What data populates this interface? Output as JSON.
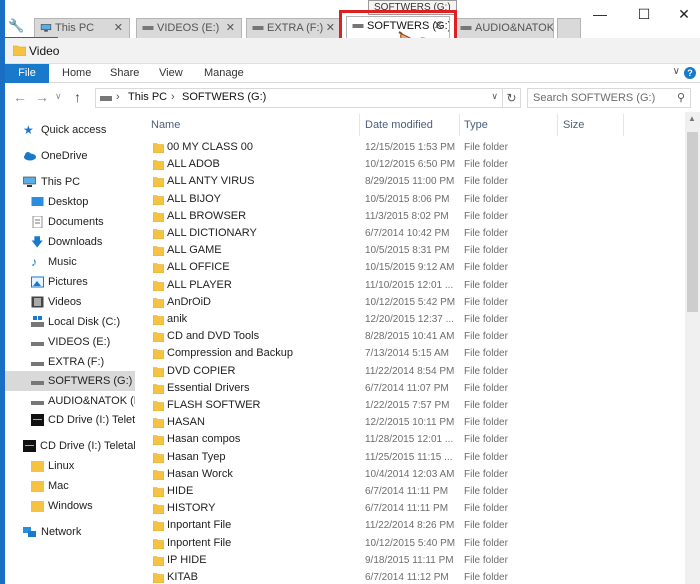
{
  "tooltip": "SOFTWERS (G:)",
  "tabs": [
    {
      "label": "This PC",
      "close": "✕"
    },
    {
      "label": "VIDEOS (E:)",
      "close": "✕"
    },
    {
      "label": "EXTRA (F:)",
      "close": "✕"
    },
    {
      "label": "SOFTWERS (G:)",
      "close": "✕"
    },
    {
      "label": "AUDIO&NATOK",
      "close": "✕"
    }
  ],
  "window_controls": {
    "minimize": "—",
    "maximize": "☐",
    "close": "✕"
  },
  "location": {
    "label": "Video"
  },
  "ribbon": {
    "file": "File",
    "home": "Home",
    "share": "Share",
    "view": "View",
    "manage": "Manage",
    "help": "?"
  },
  "address": {
    "this_pc": "This PC",
    "sep": "›",
    "drive": "SOFTWERS (G:)"
  },
  "search": {
    "placeholder": "Search SOFTWERS (G:)"
  },
  "nav": {
    "quick_access": "Quick access",
    "onedrive": "OneDrive",
    "this_pc": "This PC",
    "desktop": "Desktop",
    "documents": "Documents",
    "downloads": "Downloads",
    "music": "Music",
    "pictures": "Pictures",
    "videos": "Videos",
    "local_disk": "Local Disk (C:)",
    "videos_e": "VIDEOS (E:)",
    "extra_f": "EXTRA (F:)",
    "softwers_g": "SOFTWERS (G:)",
    "audio_h": "AUDIO&NATOK (H:",
    "cd_drive_1": "CD Drive (I:) Teletalk",
    "cd_drive_2": "CD Drive (I:) Teletalk I",
    "linux": "Linux",
    "mac": "Mac",
    "windows": "Windows",
    "network": "Network"
  },
  "columns": {
    "name": "Name",
    "date": "Date modified",
    "type": "Type",
    "size": "Size"
  },
  "files": [
    {
      "name": "00 MY CLASS 00",
      "date": "12/15/2015 1:53 PM",
      "type": "File folder"
    },
    {
      "name": "ALL ADOB",
      "date": "10/12/2015 6:50 PM",
      "type": "File folder"
    },
    {
      "name": "ALL ANTY VIRUS",
      "date": "8/29/2015 11:00 PM",
      "type": "File folder"
    },
    {
      "name": "ALL BIJOY",
      "date": "10/5/2015 8:06 PM",
      "type": "File folder"
    },
    {
      "name": "ALL BROWSER",
      "date": "11/3/2015 8:02 PM",
      "type": "File folder"
    },
    {
      "name": "ALL DICTIONARY",
      "date": "6/7/2014 10:42 PM",
      "type": "File folder"
    },
    {
      "name": "ALL GAME",
      "date": "10/5/2015 8:31 PM",
      "type": "File folder"
    },
    {
      "name": "ALL OFFICE",
      "date": "10/15/2015 9:12 AM",
      "type": "File folder"
    },
    {
      "name": "ALL PLAYER",
      "date": "11/10/2015 12:01 ...",
      "type": "File folder"
    },
    {
      "name": "AnDrOiD",
      "date": "10/12/2015 5:42 PM",
      "type": "File folder"
    },
    {
      "name": "anik",
      "date": "12/20/2015 12:37 ...",
      "type": "File folder"
    },
    {
      "name": "CD and DVD Tools",
      "date": "8/28/2015 10:41 AM",
      "type": "File folder"
    },
    {
      "name": "Compression and Backup",
      "date": "7/13/2014 5:15 AM",
      "type": "File folder"
    },
    {
      "name": "DVD COPIER",
      "date": "11/22/2014 8:54 PM",
      "type": "File folder"
    },
    {
      "name": "Essential Drivers",
      "date": "6/7/2014 11:07 PM",
      "type": "File folder"
    },
    {
      "name": "FLASH SOFTWER",
      "date": "1/22/2015 7:57 PM",
      "type": "File folder"
    },
    {
      "name": "HASAN",
      "date": "12/2/2015 10:11 PM",
      "type": "File folder"
    },
    {
      "name": "Hasan compos",
      "date": "11/28/2015 12:01 ...",
      "type": "File folder"
    },
    {
      "name": "Hasan Tyep",
      "date": "11/25/2015 11:15 ...",
      "type": "File folder"
    },
    {
      "name": "Hasan Worck",
      "date": "10/4/2014 12:03 AM",
      "type": "File folder"
    },
    {
      "name": "HIDE",
      "date": "6/7/2014 11:11 PM",
      "type": "File folder"
    },
    {
      "name": "HISTORY",
      "date": "6/7/2014 11:11 PM",
      "type": "File folder"
    },
    {
      "name": "Inportant File",
      "date": "11/22/2014 8:26 PM",
      "type": "File folder"
    },
    {
      "name": "Inportent File",
      "date": "10/12/2015 5:40 PM",
      "type": "File folder"
    },
    {
      "name": "IP HIDE",
      "date": "9/18/2015 11:11 PM",
      "type": "File folder"
    },
    {
      "name": "KITAB",
      "date": "6/7/2014 11:12 PM",
      "type": "File folder"
    }
  ],
  "colors": {
    "accent": "#1979ca",
    "highlight": "#e02020",
    "folder": "#f5c242"
  },
  "icons": [
    "wrench-icon",
    "monitor-icon",
    "drive-icon",
    "folder-icon",
    "close-icon",
    "back-icon",
    "forward-icon",
    "up-icon",
    "refresh-icon",
    "search-icon",
    "star-icon",
    "cloud-icon",
    "network-icon",
    "pointing-hand-icon"
  ]
}
